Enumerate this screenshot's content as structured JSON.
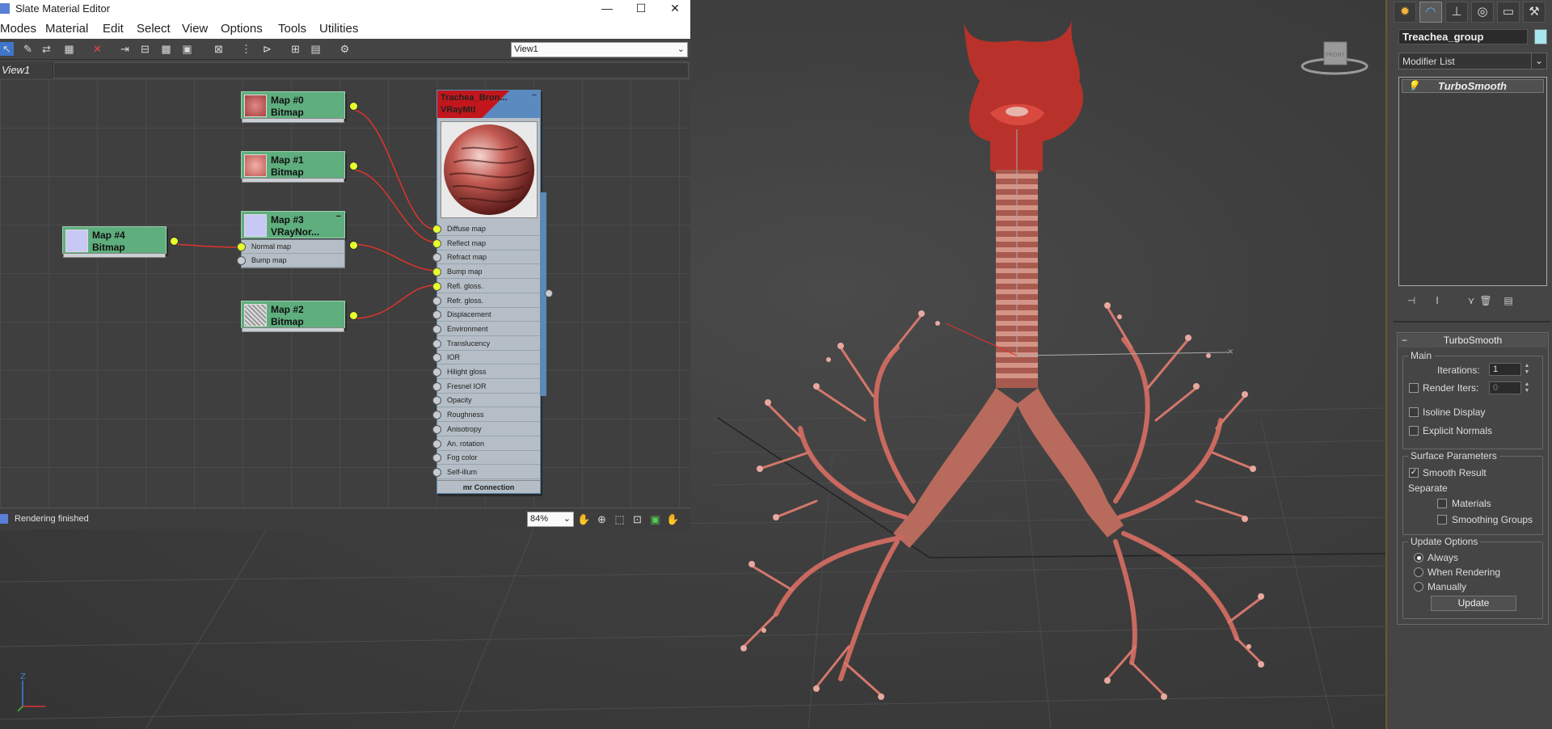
{
  "editor": {
    "title": "Slate Material Editor",
    "window_controls": [
      "—",
      "☐",
      "✕"
    ],
    "menus": [
      "Modes",
      "Material",
      "Edit",
      "Select",
      "View",
      "Options",
      "Tools",
      "Utilities"
    ],
    "view_selector": "View1",
    "active_tab": "View1",
    "nodes": [
      {
        "title": "Map #0",
        "type": "Bitmap"
      },
      {
        "title": "Map #1",
        "type": "Bitmap"
      },
      {
        "title": "Map #3",
        "type": "VRayNor...",
        "slots": [
          "Normal map",
          "Bump map"
        ]
      },
      {
        "title": "Map #4",
        "type": "Bitmap"
      },
      {
        "title": "Map #2",
        "type": "Bitmap"
      }
    ],
    "material_node": {
      "title": "Trachea_Bron...",
      "type": "VRayMtl",
      "slots": [
        "Diffuse map",
        "Reflect map",
        "Refract map",
        "Bump map",
        "Refl. gloss.",
        "Refr. gloss.",
        "Displacement",
        "Environment",
        "Translucency",
        "IOR",
        "Hilight gloss",
        "Fresnel IOR",
        "Opacity",
        "Roughness",
        "Anisotropy",
        "An. rotation",
        "Fog color",
        "Self-illum"
      ],
      "connected_slots": [
        0,
        1,
        3,
        4
      ],
      "footer": "mr Connection"
    },
    "status": "Rendering finished",
    "zoom": "84%"
  },
  "command_panel": {
    "object_name": "Treachea_group",
    "object_color": "#a8e6ee",
    "modifier_list": "Modifier List",
    "stack_item": "TurboSmooth",
    "rollout_title": "TurboSmooth",
    "main_group": "Main",
    "iterations_label": "Iterations:",
    "iterations_value": "1",
    "render_iters_label": "Render Iters:",
    "render_iters_value": "0",
    "render_iters_checked": false,
    "isoline_label": "Isoline Display",
    "isoline_checked": false,
    "explicit_normals_label": "Explicit Normals",
    "explicit_normals_checked": false,
    "surface_group": "Surface Parameters",
    "smooth_result_label": "Smooth Result",
    "smooth_result_checked": true,
    "separate_label": "Separate",
    "materials_label": "Materials",
    "materials_checked": false,
    "smoothing_groups_label": "Smoothing Groups",
    "smoothing_groups_checked": false,
    "update_group": "Update Options",
    "update_options": [
      "Always",
      "When Rendering",
      "Manually"
    ],
    "update_selected": 0,
    "update_button": "Update"
  },
  "viewport": {
    "viewcube_label": "FRONT",
    "gizmo_label": "Z",
    "model_color": "#c55a50"
  }
}
